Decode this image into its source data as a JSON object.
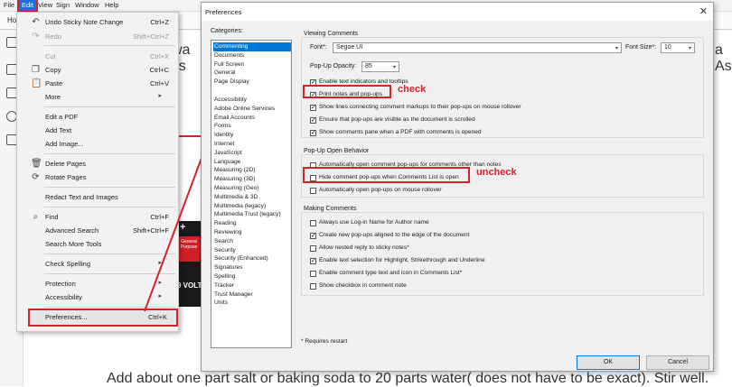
{
  "menubar": {
    "items": [
      "File",
      "Edit",
      "View",
      "Sign",
      "Window",
      "Help"
    ]
  },
  "toolbar": {
    "home_tab": "Ho"
  },
  "background": {
    "text_left_1": "wa",
    "text_left_2": "nds",
    "text_right_1": "a",
    "text_right_2": "As",
    "bottom_text": "Add about one part salt or baking soda to 20 parts water( does not have to be exact). Stir well.",
    "book_label": "General Purpose",
    "book_plus": "+",
    "book_vol": "9 VOLT"
  },
  "edit_menu": {
    "items": [
      {
        "icon": "undo-icon",
        "label": "Undo Sticky Note Change",
        "shortcut": "Ctrl+Z",
        "disabled": false
      },
      {
        "icon": "redo-icon",
        "label": "Redo",
        "shortcut": "Shift+Ctrl+Z",
        "disabled": true
      },
      {
        "icon": "",
        "label": "Cut",
        "shortcut": "Ctrl+X",
        "disabled": true
      },
      {
        "icon": "copy-icon",
        "label": "Copy",
        "shortcut": "Ctrl+C",
        "disabled": false
      },
      {
        "icon": "paste-icon",
        "label": "Paste",
        "shortcut": "Ctrl+V",
        "disabled": false
      },
      {
        "icon": "",
        "label": "More",
        "shortcut": "",
        "disabled": false
      },
      {
        "icon": "",
        "label": "Edit a PDF",
        "shortcut": "",
        "disabled": false
      },
      {
        "icon": "",
        "label": "Add Text",
        "shortcut": "",
        "disabled": false
      },
      {
        "icon": "",
        "label": "Add Image...",
        "shortcut": "",
        "disabled": false
      },
      {
        "icon": "delete-pages-icon",
        "label": "Delete Pages",
        "shortcut": "",
        "disabled": false
      },
      {
        "icon": "rotate-pages-icon",
        "label": "Rotate Pages",
        "shortcut": "",
        "disabled": false
      },
      {
        "icon": "",
        "label": "Redact Text and Images",
        "shortcut": "",
        "disabled": false
      },
      {
        "icon": "search-icon",
        "label": "Find",
        "shortcut": "Ctrl+F",
        "disabled": false
      },
      {
        "icon": "",
        "label": "Advanced Search",
        "shortcut": "Shift+Ctrl+F",
        "disabled": false
      },
      {
        "icon": "",
        "label": "Search More Tools",
        "shortcut": "",
        "disabled": false
      },
      {
        "icon": "",
        "label": "Check Spelling",
        "shortcut": "",
        "disabled": false
      },
      {
        "icon": "",
        "label": "Protection",
        "shortcut": "",
        "disabled": false
      },
      {
        "icon": "",
        "label": "Accessibility",
        "shortcut": "",
        "disabled": false
      },
      {
        "icon": "",
        "label": "Preferences...",
        "shortcut": "Ctrl+K",
        "disabled": false
      }
    ]
  },
  "dialog": {
    "title": "Preferences",
    "categories_label": "Categories:",
    "categories": [
      "Commenting",
      "Documents",
      "Full Screen",
      "General",
      "Page Display",
      "Accessibility",
      "Adobe Online Services",
      "Email Accounts",
      "Forms",
      "Identity",
      "Internet",
      "JavaScript",
      "Language",
      "Measuring (2D)",
      "Measuring (3D)",
      "Measuring (Geo)",
      "Multimedia & 3D",
      "Multimedia (legacy)",
      "Multimedia Trust (legacy)",
      "Reading",
      "Reviewing",
      "Search",
      "Security",
      "Security (Enhanced)",
      "Signatures",
      "Spelling",
      "Tracker",
      "Trust Manager",
      "Units"
    ],
    "selected_category": "Commenting",
    "viewing": {
      "title": "Viewing Comments",
      "font_label": "Font*:",
      "font_value": "Segoe UI",
      "font_size_label": "Font Size*:",
      "font_size_value": "10",
      "opacity_label": "Pop-Up Opacity:",
      "opacity_value": "85",
      "options": [
        {
          "label": "Enable text indicators and tooltips",
          "checked": true
        },
        {
          "label": "Print notes and pop-ups",
          "checked": true
        },
        {
          "label": "Show lines connecting comment markups to their pop-ups on mouse rollover",
          "checked": true
        },
        {
          "label": "Ensure that pop-ups are visible as the document is scrolled",
          "checked": true
        },
        {
          "label": "Show comments pane when a PDF with comments is opened",
          "checked": true
        }
      ]
    },
    "popup": {
      "title": "Pop-Up Open Behavior",
      "options": [
        {
          "label": "Automatically open comment pop-ups for comments other than notes",
          "checked": false
        },
        {
          "label": "Hide comment pop-ups when Comments List is open",
          "checked": false
        },
        {
          "label": "Automatically open pop-ups on mouse rollover",
          "checked": false
        }
      ]
    },
    "making": {
      "title": "Making Comments",
      "options": [
        {
          "label": "Always use Log-in Name for Author name",
          "checked": false
        },
        {
          "label": "Create new pop-ups aligned to the edge of the document",
          "checked": true
        },
        {
          "label": "Allow nested reply to sticky notes*",
          "checked": false
        },
        {
          "label": "Enable text selection for Highlight, Strikethrough and Underline",
          "checked": true
        },
        {
          "label": "Enable comment type text and icon in Comments List*",
          "checked": false
        },
        {
          "label": "Show checkbox in comment note",
          "checked": false
        }
      ]
    },
    "restart_note": "* Requires restart",
    "ok_label": "OK",
    "cancel_label": "Cancel"
  },
  "annotations": {
    "check": "check",
    "uncheck": "uncheck",
    "color": "#d4242a"
  }
}
